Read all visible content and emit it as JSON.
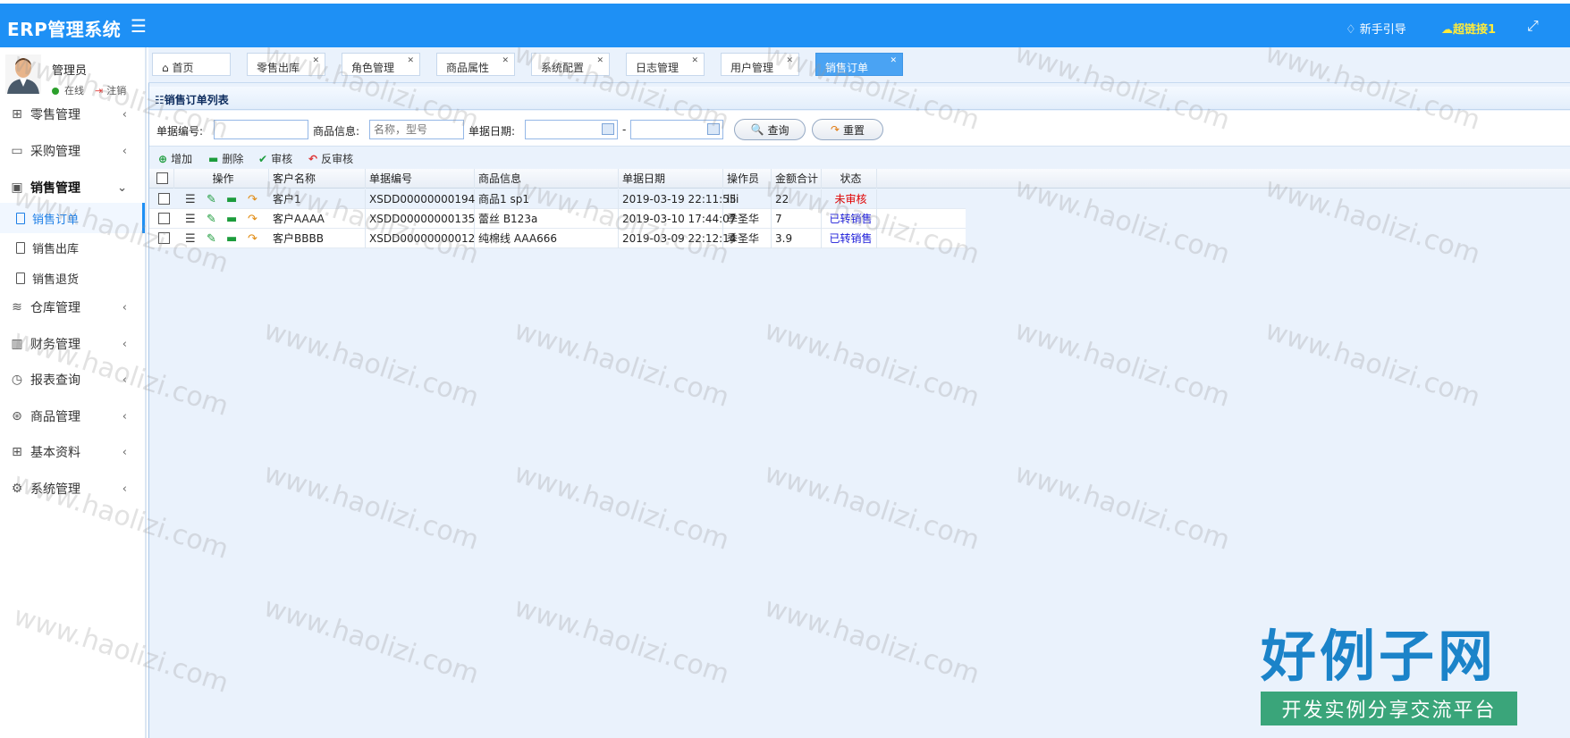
{
  "topbar": {
    "brand": "ERP管理系统",
    "menu_icon": "hamburger-icon",
    "guide": "新手引导",
    "guide_icon": "diamond-icon",
    "superlink": "超链接1",
    "superlink_icon": "cloud-icon",
    "fullscreen_icon": "expand-icon",
    "bg_color": "#1e90f5"
  },
  "user": {
    "name": "管理员",
    "status": "在线",
    "logout": "注销"
  },
  "nav": [
    {
      "label": "零售管理",
      "icon": "gift-icon"
    },
    {
      "label": "采购管理",
      "icon": "monitor-icon"
    },
    {
      "label": "销售管理",
      "icon": "briefcase-icon",
      "expanded": true
    },
    {
      "label": "仓库管理",
      "icon": "layers-icon"
    },
    {
      "label": "财务管理",
      "icon": "map-icon"
    },
    {
      "label": "报表查询",
      "icon": "clock-icon"
    },
    {
      "label": "商品管理",
      "icon": "box-icon"
    },
    {
      "label": "基本资料",
      "icon": "grid-icon"
    },
    {
      "label": "系统管理",
      "icon": "gear-icon"
    }
  ],
  "subnav": [
    {
      "label": "销售订单",
      "current": true
    },
    {
      "label": "销售出库"
    },
    {
      "label": "销售退货"
    }
  ],
  "tabs": [
    {
      "label": "首页"
    },
    {
      "label": "零售出库"
    },
    {
      "label": "角色管理"
    },
    {
      "label": "商品属性"
    },
    {
      "label": "系统配置"
    },
    {
      "label": "日志管理"
    },
    {
      "label": "用户管理"
    },
    {
      "label": "销售订单",
      "active": true
    }
  ],
  "panel": {
    "title": "销售订单列表"
  },
  "search": {
    "number_label": "单据编号:",
    "number_value": "",
    "goods_label": "商品信息:",
    "goods_placeholder": "名称，型号",
    "date_label": "单据日期:",
    "date_sep": "-",
    "query_btn": "查询",
    "reset_btn": "重置"
  },
  "toolbar": {
    "add": "增加",
    "delete": "删除",
    "audit": "审核",
    "unaudit": "反审核"
  },
  "grid": {
    "columns": [
      "操作",
      "客户名称",
      "单据编号",
      "商品信息",
      "单据日期",
      "操作员",
      "金额合计",
      "状态"
    ],
    "rows": [
      {
        "customer": "客户1",
        "number": "XSDD00000000194",
        "goods": "商品1 sp1",
        "date": "2019-03-19 22:11:55",
        "operator": "lili",
        "amount": "22",
        "status": "未审核",
        "status_color": "#e00000"
      },
      {
        "customer": "客户AAAA",
        "number": "XSDD00000000135",
        "goods": "蕾丝 B123a",
        "date": "2019-03-10 17:44:07",
        "operator": "季圣华",
        "amount": "7",
        "status": "已转销售",
        "status_color": "#1a1ad8"
      },
      {
        "customer": "客户BBBB",
        "number": "XSDD00000000012",
        "goods": "纯棉线 AAA666",
        "date": "2019-03-09 22:12:14",
        "operator": "季圣华",
        "amount": "3.9",
        "status": "已转销售",
        "status_color": "#1a1ad8"
      }
    ]
  },
  "watermark": {
    "text": "www.haolizi.com",
    "logo_big": "好例子网",
    "logo_small": "开发实例分享交流平台"
  }
}
